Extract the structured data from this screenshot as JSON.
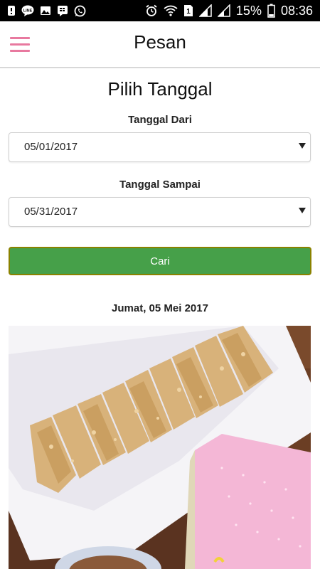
{
  "status_bar": {
    "battery": "15%",
    "time": "08:36",
    "icons_left": [
      "notification-icon",
      "line-app-icon",
      "gallery-icon",
      "bbm-icon",
      "whatsapp-icon"
    ],
    "icons_right": [
      "alarm-icon",
      "wifi-icon",
      "sim1-icon",
      "signal-icon",
      "signal2-icon",
      "battery-icon"
    ]
  },
  "appbar": {
    "title": "Pesan",
    "menu_icon": "hamburger-menu-icon",
    "accent": "#e8799f"
  },
  "page": {
    "section_title": "Pilih Tanggal",
    "from": {
      "label": "Tanggal Dari",
      "value": "05/01/2017"
    },
    "to": {
      "label": "Tanggal Sampai",
      "value": "05/31/2017"
    },
    "search_button": "Cari",
    "search_button_color": "#46a049"
  },
  "results": [
    {
      "date_label": "Jumat, 05 Mei 2017"
    }
  ]
}
